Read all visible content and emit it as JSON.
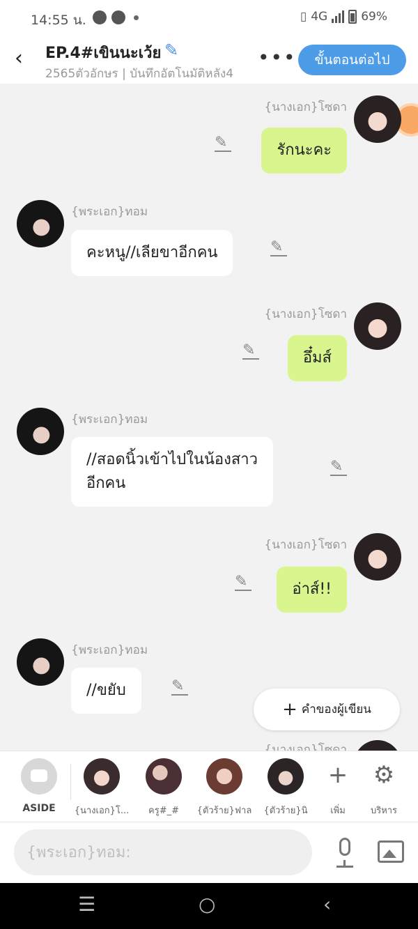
{
  "status_bar": {
    "time": "14:55 น.",
    "network": "4G",
    "battery": "69%"
  },
  "header": {
    "title": "EP.4#เขินนะเว้ย",
    "subtitle": "2565ตัวอักษร | บันทึกอัตโนมัติหลัง4",
    "next_button": "ขั้นตอนต่อไป",
    "more": "•••"
  },
  "messages": [
    {
      "side": "right",
      "name": "{นางเอก}โซดา",
      "text": "รักนะคะ"
    },
    {
      "side": "left",
      "name": "{พระเอก}ทอม",
      "text": "คะหนู//เลียขาอีกคน"
    },
    {
      "side": "right",
      "name": "{นางเอก}โซดา",
      "text": "อึ๋มส์"
    },
    {
      "side": "left",
      "name": "{พระเอก}ทอม",
      "text": "//สอดนิ้วเข้าไปในน้องสาว\nอีกคน"
    },
    {
      "side": "right",
      "name": "{นางเอก}โซดา",
      "text": "อ่าส์!!"
    },
    {
      "side": "left",
      "name": "{พระเอก}ทอม",
      "text": "//ขยับ"
    }
  ],
  "partial_name": "{นางเอก}โซดา",
  "author_note_button": "คำของผู้เขียน",
  "character_bar": {
    "aside_label": "ASIDE",
    "characters": [
      {
        "label": "{นางเอก}โ...",
        "color": "#3a2c2c"
      },
      {
        "label": "ครู#_#",
        "color": "#4a2f35"
      },
      {
        "label": "{ตัวร้าย}ฟาล",
        "color": "#6b3c32"
      },
      {
        "label": "{ตัวร้าย}นิ",
        "color": "#2b2526"
      }
    ],
    "add_label": "เพิ่ม",
    "manage_label": "บริหาร"
  },
  "input": {
    "placeholder": "{พระเอก}ทอม:"
  },
  "colors": {
    "accent": "#4c9ce8",
    "bubble_right": "#d8f58e",
    "bubble_left": "#ffffff",
    "background": "#f2f2f2"
  }
}
